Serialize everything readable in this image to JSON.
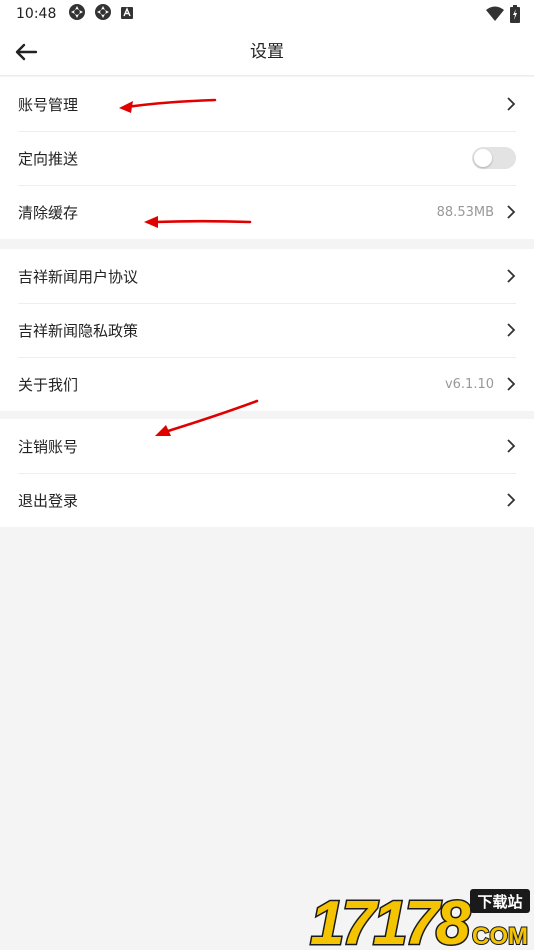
{
  "status_bar": {
    "time": "10:48"
  },
  "header": {
    "title": "设置"
  },
  "groups": [
    {
      "rows": [
        {
          "label": "账号管理"
        },
        {
          "label": "定向推送",
          "toggle_on": false
        },
        {
          "label": "清除缓存",
          "value": "88.53MB"
        }
      ]
    },
    {
      "rows": [
        {
          "label": "吉祥新闻用户协议"
        },
        {
          "label": "吉祥新闻隐私政策"
        },
        {
          "label": "关于我们",
          "value": "v6.1.10"
        }
      ]
    },
    {
      "rows": [
        {
          "label": "注销账号"
        },
        {
          "label": "退出登录"
        }
      ]
    }
  ],
  "watermark": {
    "number": "17178",
    "badge": "下载站",
    "domain": "COM"
  },
  "colors": {
    "background": "#f4f4f4",
    "card": "#ffffff",
    "text": "#222222",
    "secondary_text": "#999999",
    "toggle_off": "#e3e3e3",
    "annotation_arrow": "#e00000"
  },
  "icons": [
    "back-arrow-icon",
    "chevron-right-icon",
    "wifi-icon",
    "battery-icon",
    "notification-icon",
    "sync-icon"
  ]
}
